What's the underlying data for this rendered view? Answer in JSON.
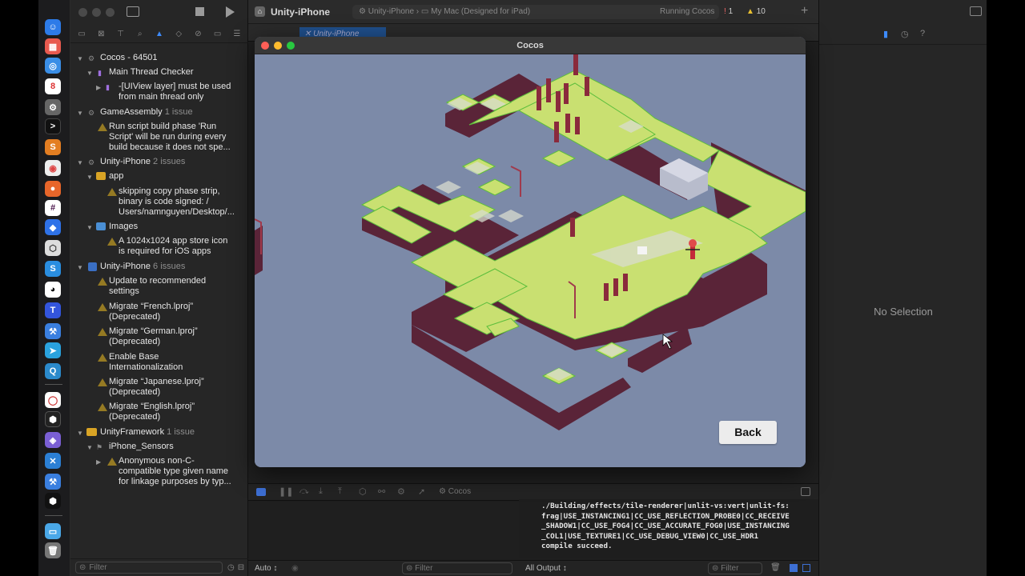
{
  "xcode": {
    "scheme_title": "Unity-iPhone",
    "breadcrumb_scheme": "Unity-iPhone",
    "breadcrumb_destination": "My Mac (Designed for iPad)",
    "status": "Running Cocos",
    "error_count": "1",
    "warning_count": "10",
    "editor_tab": "Unity-iPhone",
    "debug_process": "Cocos"
  },
  "navigator": {
    "filter_placeholder": "Filter",
    "groups": [
      {
        "label": "Cocos - 64501",
        "count": ""
      },
      {
        "label": "Main Thread Checker",
        "count": ""
      },
      {
        "label": "-[UIView layer] must be used",
        "count": ""
      },
      {
        "label": "from main thread only",
        "count": ""
      },
      {
        "label": "GameAssembly",
        "count": "1 issue"
      },
      {
        "label": "Run script build phase 'Run",
        "count": ""
      },
      {
        "label": "Script' will be run during every",
        "count": ""
      },
      {
        "label": "build because it does not spe...",
        "count": ""
      },
      {
        "label": "Unity-iPhone",
        "count": "2 issues"
      },
      {
        "label": "app",
        "count": ""
      },
      {
        "label": "skipping copy phase strip,",
        "count": ""
      },
      {
        "label": "binary is code signed: /",
        "count": ""
      },
      {
        "label": "Users/namnguyen/Desktop/...",
        "count": ""
      },
      {
        "label": "Images",
        "count": ""
      },
      {
        "label": "A 1024x1024 app store icon",
        "count": ""
      },
      {
        "label": "is required for iOS apps",
        "count": ""
      },
      {
        "label": "Unity-iPhone",
        "count": "6 issues"
      },
      {
        "label": "Update to recommended",
        "count": ""
      },
      {
        "label": "settings",
        "count": ""
      },
      {
        "label": "Migrate “French.lproj”",
        "count": ""
      },
      {
        "label": "(Deprecated)",
        "count": ""
      },
      {
        "label": "Migrate “German.lproj”",
        "count": ""
      },
      {
        "label": "(Deprecated)",
        "count": ""
      },
      {
        "label": "Enable Base",
        "count": ""
      },
      {
        "label": "Internationalization",
        "count": ""
      },
      {
        "label": "Migrate “Japanese.lproj”",
        "count": ""
      },
      {
        "label": "(Deprecated)",
        "count": ""
      },
      {
        "label": "Migrate “English.lproj”",
        "count": ""
      },
      {
        "label": "(Deprecated)",
        "count": ""
      },
      {
        "label": "UnityFramework",
        "count": "1 issue"
      },
      {
        "label": "iPhone_Sensors",
        "count": ""
      },
      {
        "label": "Anonymous non-C-",
        "count": ""
      },
      {
        "label": "compatible type given name",
        "count": ""
      },
      {
        "label": "for linkage purposes by typ...",
        "count": ""
      }
    ]
  },
  "cocos_window": {
    "title": "Cocos",
    "back_label": "Back"
  },
  "console": {
    "lines": "./Building/effects/tile-renderer|unlit-vs:vert|unlit-fs:\nfrag|USE_INSTANCING1|CC_USE_REFLECTION_PROBE0|CC_RECEIVE\n_SHADOW1|CC_USE_FOG4|CC_USE_ACCURATE_FOG0|USE_INSTANCING\n_COL1|USE_TEXTURE1|CC_USE_DEBUG_VIEW0|CC_USE_HDR1\ncompile succeed."
  },
  "bottom": {
    "auto_label": "Auto ↕",
    "filter_left": "Filter",
    "output_label": "All Output ↕",
    "filter_right": "Filter"
  },
  "inspector": {
    "empty_label": "No Selection"
  },
  "colors": {
    "grass": "#c9e071",
    "grass_edge": "#5cbe3c",
    "dirt": "#5a2438",
    "sky": "#7c8aa8",
    "accent": "#3d8bfd"
  }
}
